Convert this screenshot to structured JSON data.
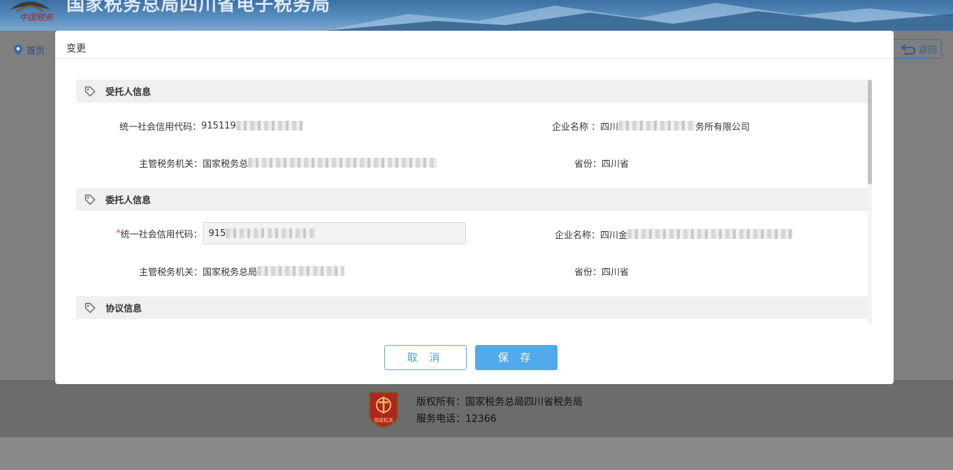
{
  "header": {
    "site_title": "国家税务总局四川省电子税务局",
    "logo_text": "中国税务"
  },
  "breadcrumb": {
    "home": "首页"
  },
  "back_button": {
    "label": "返回"
  },
  "modal": {
    "title": "变更",
    "sections": [
      {
        "title": "受托人信息",
        "fields": {
          "credit_code_label": "统一社会信用代码：",
          "credit_code_value": "915119",
          "company_label": "企业名称 ：",
          "company_value_prefix": "四川",
          "company_value_suffix": "务所有限公司",
          "tax_office_label": "主管税务机关：",
          "tax_office_value": "国家税务总",
          "province_label": "省份：",
          "province_value": "四川省"
        }
      },
      {
        "title": "委托人信息",
        "fields": {
          "credit_code_required": "*",
          "credit_code_label": "统一社会信用代码：",
          "credit_code_input": "915",
          "company_label": "企业名称：",
          "company_value_prefix": "四川金",
          "tax_office_label": "主管税务机关：",
          "tax_office_value": "国家税务总局",
          "province_label": "省份：",
          "province_value": "四川省"
        }
      },
      {
        "title": "协议信息"
      }
    ],
    "buttons": {
      "cancel": "取 消",
      "save": "保 存"
    }
  },
  "footer": {
    "copyright": "版权所有：国家税务总局四川省税务局",
    "phone": "服务电话：12366",
    "badge_text": "党政机关"
  },
  "colors": {
    "primary": "#51abeb",
    "header_blue": "#3c6fa3",
    "required": "#ee3333"
  }
}
